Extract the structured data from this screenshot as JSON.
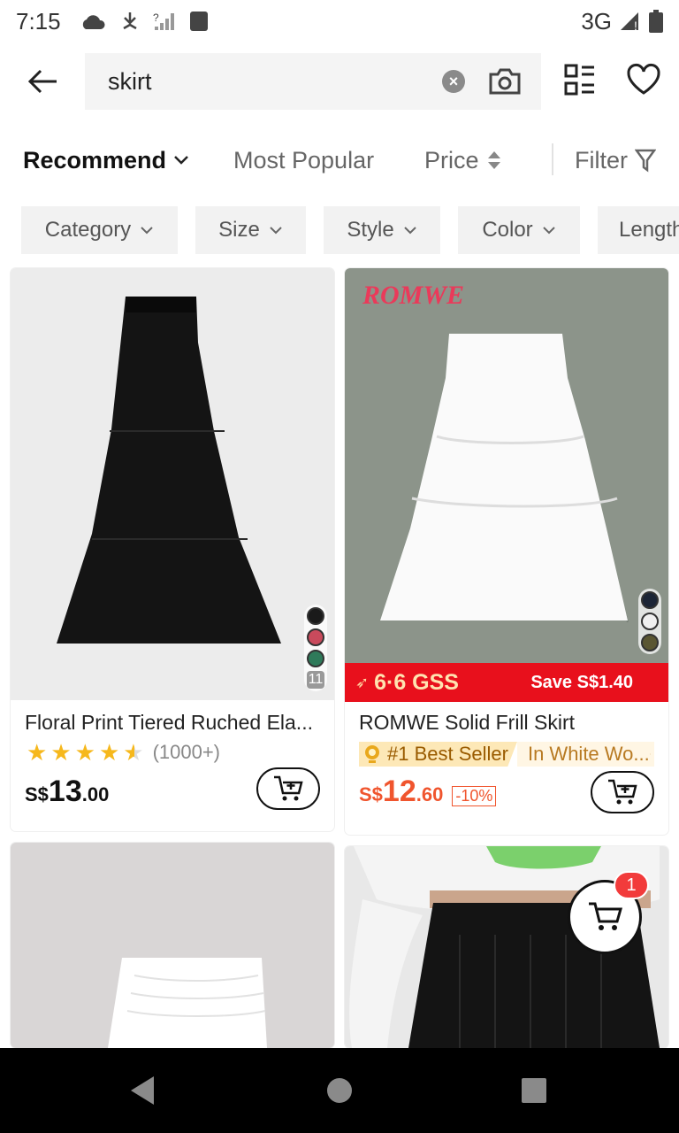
{
  "status_bar": {
    "time": "7:15",
    "network": "3G"
  },
  "search": {
    "query": "skirt"
  },
  "sort_tabs": [
    {
      "label": "Recommend",
      "active": true
    },
    {
      "label": "Most Popular",
      "active": false
    },
    {
      "label": "Price",
      "active": false
    },
    {
      "label": "Filter",
      "active": false
    }
  ],
  "filter_chips": [
    "Category",
    "Size",
    "Style",
    "Color",
    "Length"
  ],
  "products": [
    {
      "title": "Floral Print Tiered Ruched Ela...",
      "rating": 4.5,
      "review_count": "(1000+)",
      "currency": "S$",
      "price_int": "13",
      "price_dec": ".00",
      "color_count": "11",
      "swatch_colors": [
        "#1a1a1a",
        "#c94a5c",
        "#2f7a5a"
      ],
      "image_bg": "#ececec",
      "garment_color": "#141414"
    },
    {
      "brand": "ROMWE",
      "title": "ROMWE Solid Frill Skirt",
      "badge": "#1 Best Seller",
      "badge_context": "In White Wo...",
      "promo_left": "6·6 GSS",
      "promo_right": "Save S$1.40",
      "currency": "S$",
      "price_int": "12",
      "price_dec": ".60",
      "discount": "-10%",
      "swatch_colors": [
        "#1c2536",
        "#f0f0f0",
        "#5a5632"
      ],
      "image_bg": "#8c948a",
      "garment_color": "#fafafa"
    },
    {
      "image_bg": "#d9d6d6",
      "garment_color": "#ffffff"
    },
    {
      "image_bg": "#e8e8e8",
      "garment_color": "#141414"
    }
  ],
  "cart": {
    "count": "1"
  },
  "colors": {
    "accent_red": "#e8101c",
    "price_orange": "#f0552e",
    "star": "#f6b81c"
  }
}
